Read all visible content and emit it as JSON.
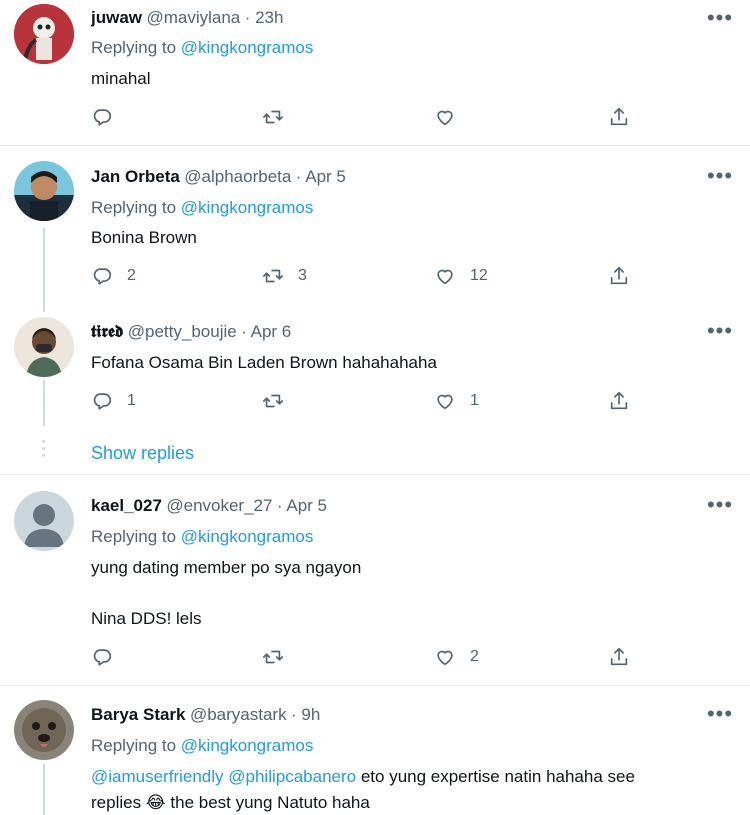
{
  "tweets": [
    {
      "name": "juwaw",
      "handle": "@maviylana",
      "time": "· 23h",
      "replying_prefix": "Replying to",
      "replying_to": "@kingkongramos",
      "text": "minahal",
      "replies": "",
      "retweets": "",
      "likes": ""
    },
    {
      "name": "Jan Orbeta",
      "handle": "@alphaorbeta",
      "time": "· Apr 5",
      "replying_prefix": "Replying to",
      "replying_to": "@kingkongramos",
      "text": "Bonina Brown",
      "replies": "2",
      "retweets": "3",
      "likes": "12"
    },
    {
      "name": "𝖙𝖎𝖗𝖊𝖉",
      "handle": "@petty_boujie",
      "time": "· Apr 6",
      "text": "Fofana Osama Bin Laden Brown hahahahaha",
      "replies": "1",
      "retweets": "",
      "likes": "1"
    },
    {
      "name": "kael_027",
      "handle": "@envoker_27",
      "time": "· Apr 5",
      "replying_prefix": "Replying to",
      "replying_to": "@kingkongramos",
      "text_line1": "yung dating member po sya ngayon",
      "text_line2": "Nina DDS! lels",
      "replies": "",
      "retweets": "",
      "likes": "2"
    },
    {
      "name": "Barya Stark",
      "handle": "@baryastark",
      "time": "· 9h",
      "replying_prefix": "Replying to",
      "replying_to": "@kingkongramos",
      "mention1": "@iamuserfriendly",
      "mention2": "@philipcabanero",
      "text_after_mentions": " eto yung expertise natin hahaha see",
      "text_line2": "replies 😂 the best yung Natuto haha"
    }
  ],
  "show_replies": "Show replies",
  "more_label": "•••",
  "colors": {
    "accent": "#1d9bf0",
    "muted": "#536471",
    "text": "#0f1419",
    "border": "#e6e9eb"
  },
  "icons": [
    "reply-icon",
    "retweet-icon",
    "like-icon",
    "share-icon",
    "more-icon"
  ]
}
